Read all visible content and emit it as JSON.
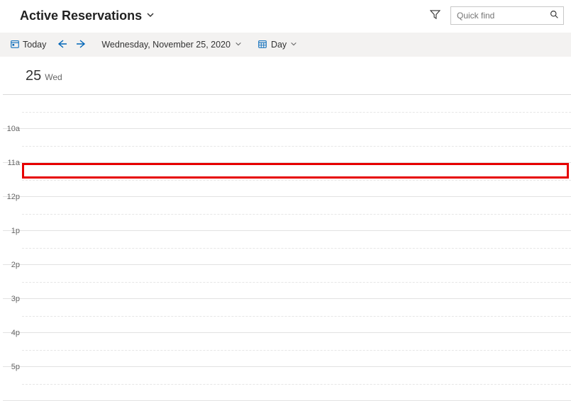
{
  "header": {
    "title": "Active Reservations",
    "search_placeholder": "Quick find"
  },
  "toolbar": {
    "today_label": "Today",
    "date_text": "Wednesday, November 25, 2020",
    "view_label": "Day"
  },
  "day_header": {
    "day_number": "25",
    "day_name": "Wed"
  },
  "hours": [
    "",
    "10a",
    "11a",
    "12p",
    "1p",
    "2p",
    "3p",
    "4p",
    "5p"
  ],
  "highlight_hour_index": 2,
  "icons": {
    "chevron_down": "chevron-down",
    "filter": "filter",
    "search": "search",
    "calendar": "calendar",
    "arrow_left": "arrow-left",
    "arrow_right": "arrow-right",
    "calendar_grid": "calendar-grid"
  }
}
